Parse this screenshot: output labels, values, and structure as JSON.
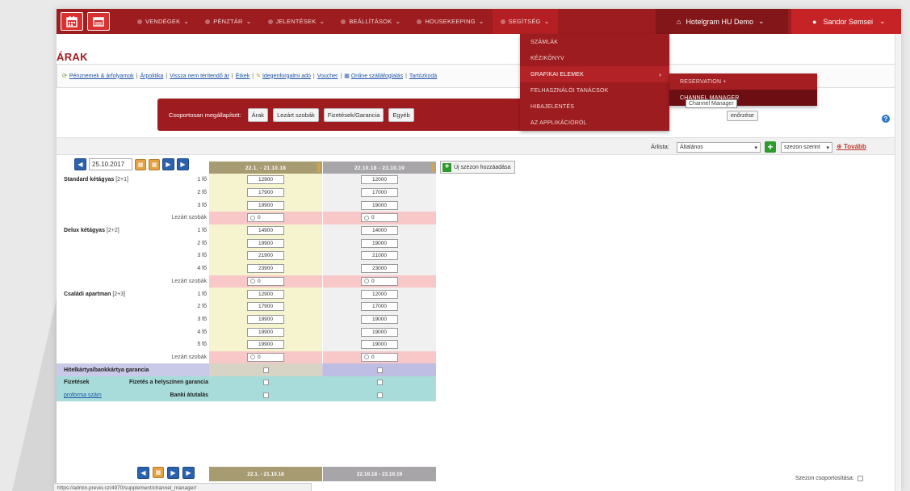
{
  "topbar": {
    "menu": [
      {
        "label": "Vendégek"
      },
      {
        "label": "Pénztár"
      },
      {
        "label": "Jelentések"
      },
      {
        "label": "Beállítások"
      },
      {
        "label": "Housekeeping"
      },
      {
        "label": "Segítség"
      }
    ],
    "hotel": "Hotelgram HU Demo",
    "user": "Sandor Semsei"
  },
  "dropdown": {
    "items": [
      "Számlák",
      "Kézikönyv",
      "Grafikai elemek",
      "Felhasználói tanácsok",
      "Hibajelentés",
      "Az applikációról"
    ],
    "submenu": [
      "Reservation +",
      "Channel manager"
    ],
    "tooltip": "Channel Manager"
  },
  "page": {
    "title": "ÁRAK",
    "links": [
      "Pénznemek & árfolyamok",
      "Árpolitika",
      "Vissza nem térítendő ár",
      "Étkek",
      "Idegenforgalmi adó",
      "Voucher",
      "Online szálláfoglalás",
      "Tartózkodá"
    ]
  },
  "group": {
    "label": "Csoportosan megállapított:",
    "buttons": [
      "Árak",
      "Lezárt szobák",
      "Fizetések/Garancia",
      "Egyéb"
    ],
    "ellenorzes": "enőrzése"
  },
  "filter": {
    "arlista_label": "Árlista:",
    "arlista_value": "Általános",
    "mode_value": "szezon szerint",
    "tovabb": "Tovább"
  },
  "grid": {
    "date": "25.10.2017",
    "seasons": [
      "22.1. - 21.10.18",
      "22.10.18 - 23.10.19"
    ],
    "new_season": "Új szezon hozzáadása",
    "closed_label": "Lezárt szobák",
    "closed_value": "0",
    "rooms": [
      {
        "name": "Standard kétágyas",
        "cap": "[2+1]",
        "rows": [
          {
            "pers": "1 fő",
            "p1": "12900",
            "p2": "12000"
          },
          {
            "pers": "2 fő",
            "p1": "17900",
            "p2": "17000"
          },
          {
            "pers": "3 fő",
            "p1": "19900",
            "p2": "19000"
          }
        ]
      },
      {
        "name": "Delux kétágyas",
        "cap": "[2+2]",
        "rows": [
          {
            "pers": "1 fő",
            "p1": "14900",
            "p2": "14000"
          },
          {
            "pers": "2 fő",
            "p1": "19900",
            "p2": "19000"
          },
          {
            "pers": "3 fő",
            "p1": "21900",
            "p2": "21000"
          },
          {
            "pers": "4 fő",
            "p1": "23900",
            "p2": "23000"
          }
        ]
      },
      {
        "name": "Családi apartman",
        "cap": "[2+3]",
        "rows": [
          {
            "pers": "1 fő",
            "p1": "12900",
            "p2": "12000"
          },
          {
            "pers": "2 fő",
            "p1": "17900",
            "p2": "17000"
          },
          {
            "pers": "3 fő",
            "p1": "19900",
            "p2": "19000"
          },
          {
            "pers": "4 fő",
            "p1": "19900",
            "p2": "19000"
          },
          {
            "pers": "5 fő",
            "p1": "19900",
            "p2": "19000"
          }
        ]
      }
    ],
    "guarantee_label": "Hitelkártya/bankkártya garancia",
    "payments_label": "Fizetések",
    "pay_onsite": "Fizetés a helyszínen garancia",
    "proforma": "proforma szám",
    "bank_transfer": "Banki átutalás"
  },
  "status": {
    "url": "https://admin.previo.cz/4970/supplement/channel_manager/",
    "szezon_csoport": "Szezon csoportosítása:"
  }
}
